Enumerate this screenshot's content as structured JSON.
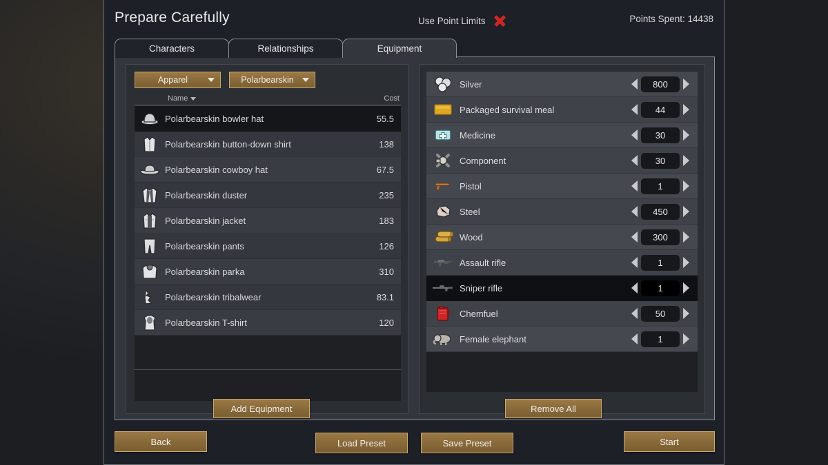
{
  "window": {
    "title": "Prepare Carefully",
    "point_limits_label": "Use Point Limits",
    "point_limits_icon": "red-x-icon",
    "point_limits_enabled": false,
    "points_spent_label": "Points Spent: 14438"
  },
  "tabs": [
    {
      "label": "Characters",
      "active": false
    },
    {
      "label": "Relationships",
      "active": false
    },
    {
      "label": "Equipment",
      "active": true
    }
  ],
  "left_panel": {
    "filters": [
      {
        "name": "category-dropdown",
        "value": "Apparel",
        "icon": "chevron-down-icon"
      },
      {
        "name": "material-dropdown",
        "value": "Polarbearskin",
        "icon": "chevron-down-icon"
      }
    ],
    "columns": {
      "name": "Name",
      "cost": "Cost",
      "sort_icon": "sort-descending-icon"
    },
    "items": [
      {
        "name": "Polarbearskin bowler hat",
        "cost": "55.5",
        "icon": "bowler-hat-icon",
        "selected": true
      },
      {
        "name": "Polarbearskin button-down shirt",
        "cost": "138",
        "icon": "shirt-icon",
        "selected": false
      },
      {
        "name": "Polarbearskin cowboy hat",
        "cost": "67.5",
        "icon": "cowboy-hat-icon",
        "selected": false
      },
      {
        "name": "Polarbearskin duster",
        "cost": "235",
        "icon": "duster-icon",
        "selected": false
      },
      {
        "name": "Polarbearskin jacket",
        "cost": "183",
        "icon": "jacket-icon",
        "selected": false
      },
      {
        "name": "Polarbearskin pants",
        "cost": "126",
        "icon": "pants-icon",
        "selected": false
      },
      {
        "name": "Polarbearskin parka",
        "cost": "310",
        "icon": "parka-icon",
        "selected": false
      },
      {
        "name": "Polarbearskin tribalwear",
        "cost": "83.1",
        "icon": "tribalwear-icon",
        "selected": false
      },
      {
        "name": "Polarbearskin T-shirt",
        "cost": "120",
        "icon": "tshirt-icon",
        "selected": false
      }
    ],
    "add_button": "Add Equipment"
  },
  "right_panel": {
    "items": [
      {
        "name": "Silver",
        "count": "800",
        "icon": "silver-icon",
        "selected": false
      },
      {
        "name": "Packaged survival meal",
        "count": "44",
        "icon": "meal-icon",
        "selected": false
      },
      {
        "name": "Medicine",
        "count": "30",
        "icon": "medicine-icon",
        "selected": false
      },
      {
        "name": "Component",
        "count": "30",
        "icon": "component-icon",
        "selected": false
      },
      {
        "name": "Pistol",
        "count": "1",
        "icon": "pistol-icon",
        "selected": false
      },
      {
        "name": "Steel",
        "count": "450",
        "icon": "steel-icon",
        "selected": false
      },
      {
        "name": "Wood",
        "count": "300",
        "icon": "wood-icon",
        "selected": false
      },
      {
        "name": "Assault rifle",
        "count": "1",
        "icon": "assault-rifle-icon",
        "selected": false
      },
      {
        "name": "Sniper rifle",
        "count": "1",
        "icon": "sniper-rifle-icon",
        "selected": true
      },
      {
        "name": "Chemfuel",
        "count": "50",
        "icon": "chemfuel-icon",
        "selected": false
      },
      {
        "name": "Female elephant",
        "count": "1",
        "icon": "elephant-icon",
        "selected": false
      }
    ],
    "decrement_icon": "arrow-left-icon",
    "increment_icon": "arrow-right-icon",
    "remove_button": "Remove All"
  },
  "footer": {
    "back": "Back",
    "load_preset": "Load Preset",
    "save_preset": "Save Preset",
    "start": "Start"
  },
  "colors": {
    "button_brown": "#8a6b3b",
    "button_border": "#c9a96f",
    "panel_bg": "#2b2e33",
    "dialog_bg": "#1d2026",
    "accent_red": "#cf2525"
  }
}
